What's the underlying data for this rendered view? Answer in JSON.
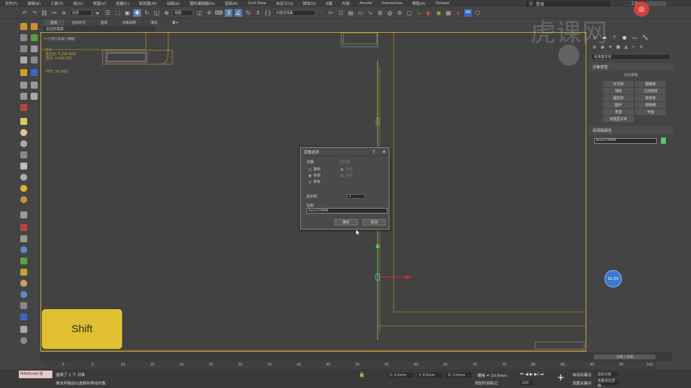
{
  "menu": {
    "items": [
      "文件(F)",
      "编辑(E)",
      "工具(T)",
      "组(G)",
      "视图(V)",
      "创建(C)",
      "修改器(M)",
      "动画(A)",
      "图形编辑器(D)",
      "渲染(R)",
      "Civil View",
      "自定义(U)",
      "脚本(S)",
      "Ε键",
      "内容",
      "Arnold",
      "Interactive",
      "帮助(H)",
      "Octane"
    ],
    "user_label": "登录",
    "workspace_label": "工作区:"
  },
  "toolbar": {
    "selection_filter": "全部",
    "view_select": "视图",
    "named_selection": "创建选择集"
  },
  "ribbon": {
    "tabs": [
      "建模",
      "自由形式",
      "选择",
      "对象绘制",
      "填充"
    ],
    "sub_label": "多边形建模"
  },
  "viewport": {
    "label": "[+] [顶] [标准] [线框]",
    "stats_total": "总计",
    "stats_polys": "多边形: 5,297,828",
    "stats_verts": "顶点:    4,420,050",
    "fps": "FPS:    31.697"
  },
  "dialog": {
    "title": "克隆选项",
    "help": "?",
    "close": "✕",
    "object_group": "对象",
    "object_options": [
      "复制",
      "实例",
      "参考"
    ],
    "object_selected": 1,
    "controller_group": "控制器",
    "controller_options": [
      "复制",
      "实例"
    ],
    "copies_label": "副本数:",
    "copies_value": "1",
    "name_label": "名称:",
    "name_value": "Box1579699",
    "ok": "确定",
    "cancel": "取消"
  },
  "command_panel": {
    "category": "标准基本体",
    "section_object_type": "对象类型",
    "autogrid": "自动栅格",
    "primitives": [
      "长方体",
      "圆锥体",
      "球体",
      "几何球体",
      "圆柱体",
      "管状体",
      "圆环",
      "四棱锥",
      "茶壶",
      "平面",
      "加强型文本"
    ],
    "section_name_color": "名称和颜色",
    "object_name": "Box1579699",
    "object_color": "#5cc878"
  },
  "timeline": {
    "position": "100 / 100",
    "ticks": [
      "0",
      "5",
      "10",
      "15",
      "20",
      "25",
      "30",
      "35",
      "40",
      "45",
      "50",
      "55",
      "60",
      "65",
      "70",
      "75",
      "80",
      "85",
      "90",
      "95",
      "100"
    ]
  },
  "status": {
    "maxscript": "MAXScript 迷",
    "selected": "选择了 1 个 对象",
    "hint": "单击并拖动以选择并移动对象",
    "x": "X: 0.0mm",
    "y": "Y: 0.0mm",
    "z": "Z: 0.0mm",
    "grid": "栅格 = 10.0mm",
    "add_time_tag": "添加时间标记",
    "auto_key": "自动关键点",
    "selected_obj": "选定对象",
    "set_key": "设置关键点",
    "key_filter": "关键点过滤器...",
    "frame": "100"
  },
  "overlay": {
    "key": "Shift",
    "timer": "02:55",
    "watermark": "虎课网"
  }
}
